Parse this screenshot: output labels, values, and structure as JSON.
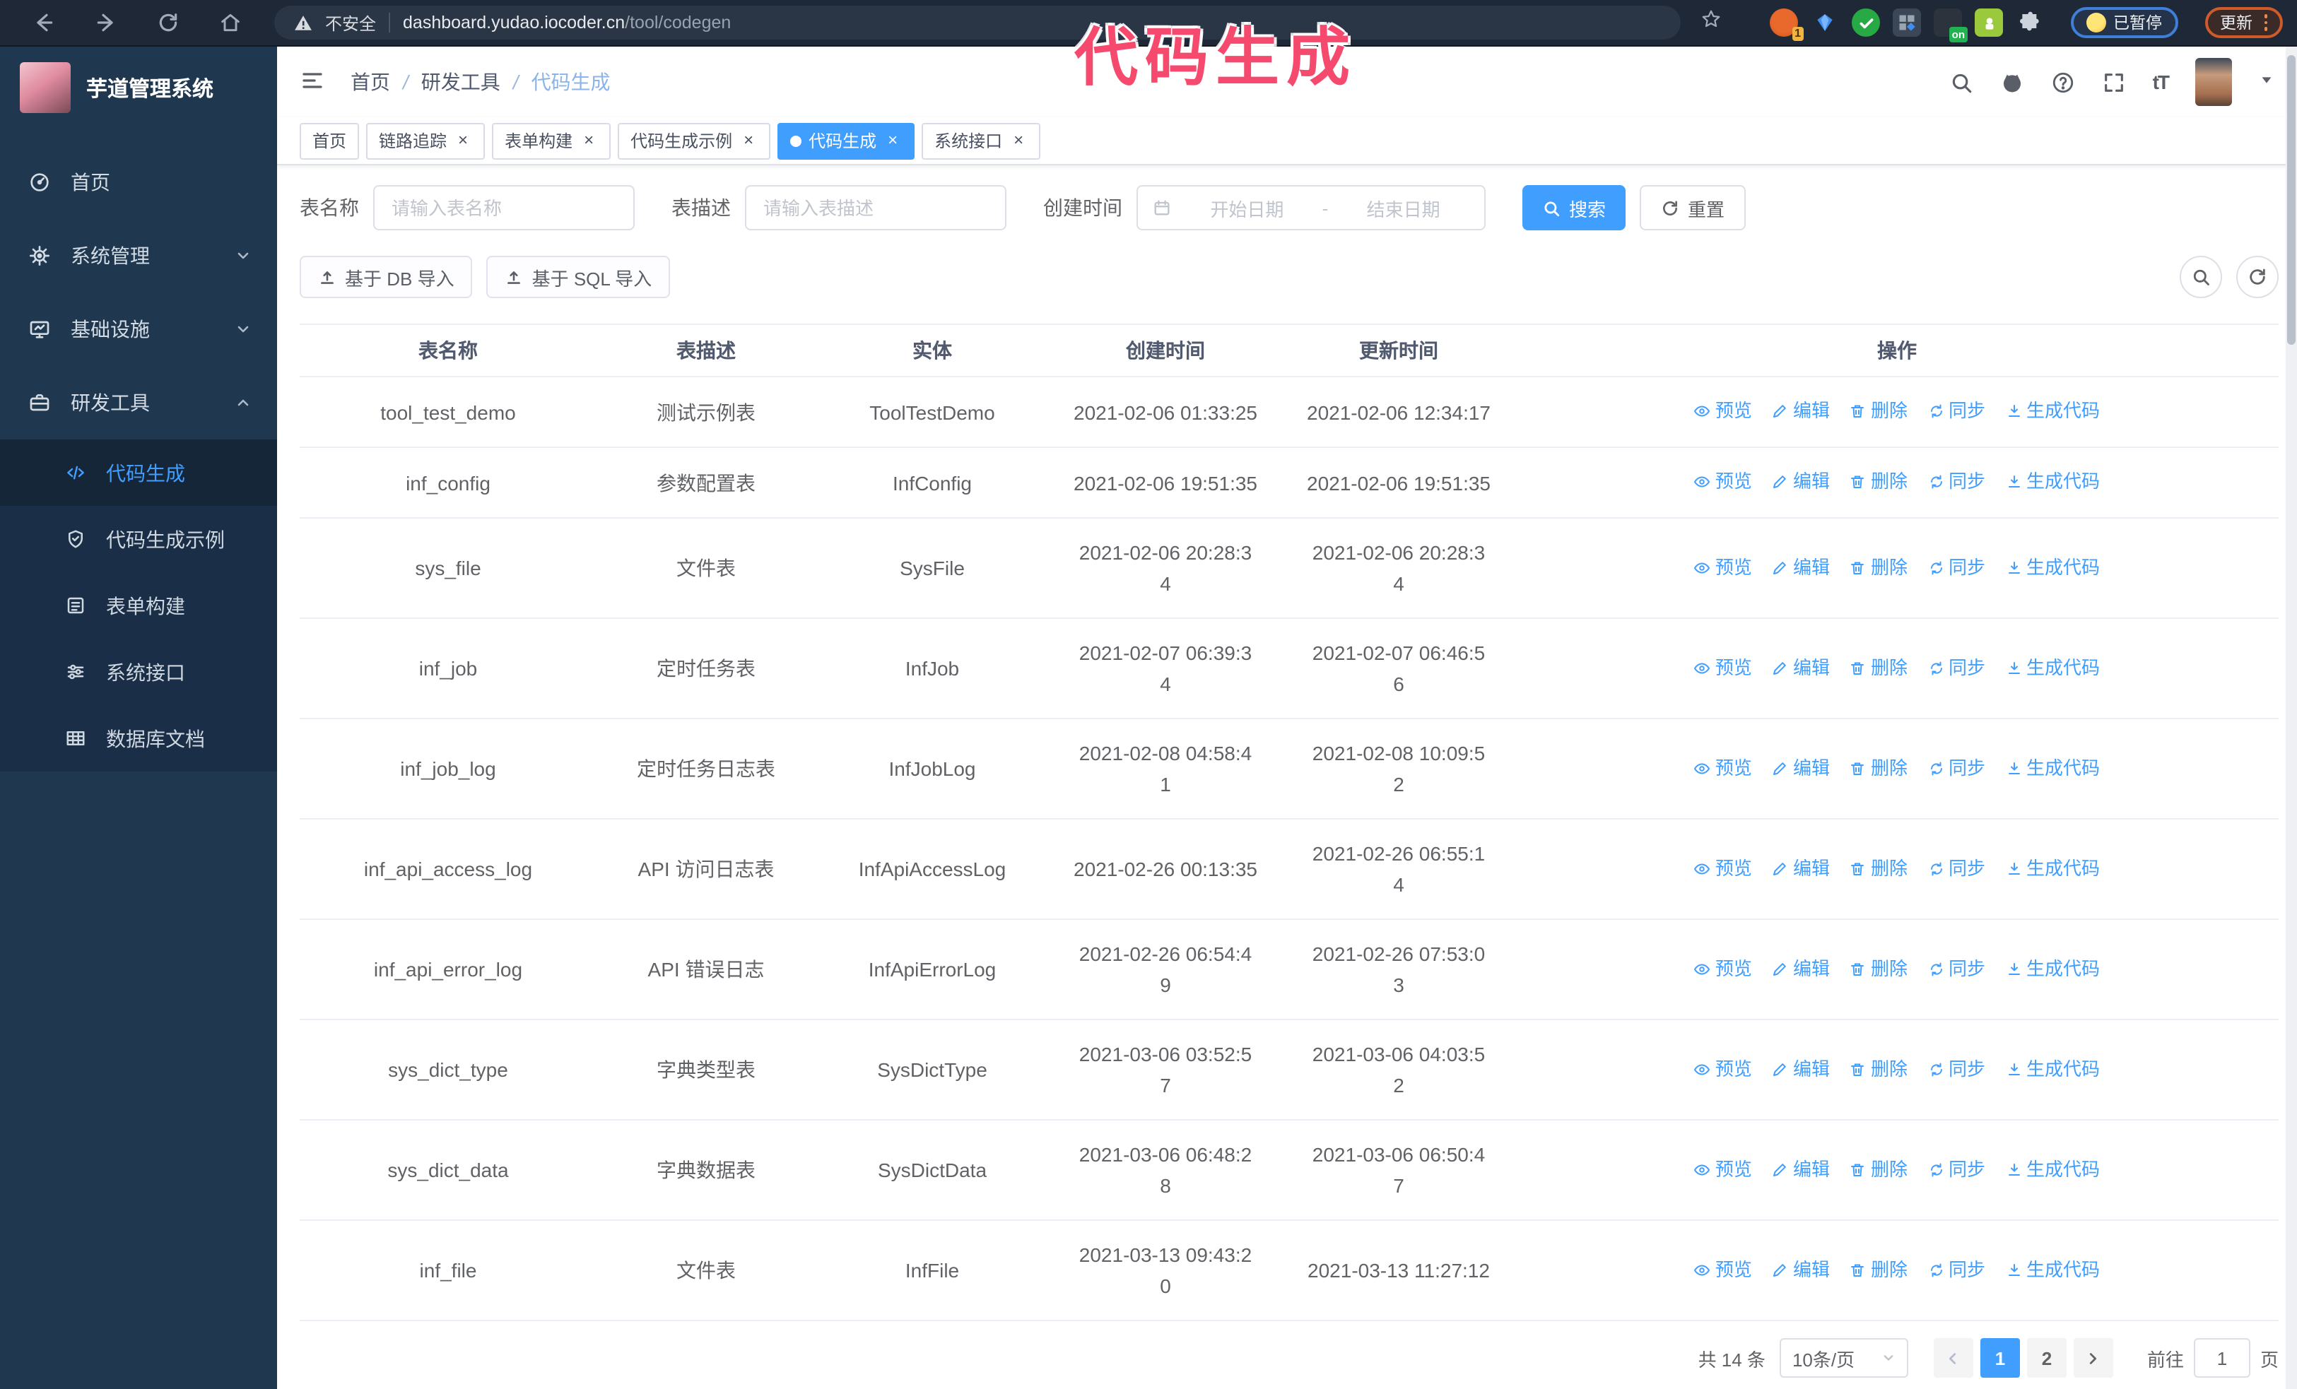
{
  "colors": {
    "accent": "#409eff",
    "annotation": "#f54a6e",
    "sidebar_bg": "#20384f",
    "sidebar_sub_bg": "#1a2f47"
  },
  "browser": {
    "not_secure": "不安全",
    "url_domain": "dashboard.yudao.iocoder.cn",
    "url_path": "/tool/codegen",
    "ext_badge": "1",
    "ext_on_badge": "on",
    "paused_label": "已暂停",
    "update_label": "更新"
  },
  "annotation": {
    "text": "代码生成"
  },
  "sidebar": {
    "title": "芋道管理系统",
    "items": [
      {
        "label": "首页",
        "icon": "dashboard-icon"
      },
      {
        "label": "系统管理",
        "icon": "gear-icon",
        "chevron": "down"
      },
      {
        "label": "基础设施",
        "icon": "monitor-icon",
        "chevron": "down"
      },
      {
        "label": "研发工具",
        "icon": "toolbox-icon",
        "chevron": "up"
      }
    ],
    "sub_items": [
      {
        "label": "代码生成",
        "icon": "code-icon",
        "active": true
      },
      {
        "label": "代码生成示例",
        "icon": "shield-check-icon"
      },
      {
        "label": "表单构建",
        "icon": "form-icon"
      },
      {
        "label": "系统接口",
        "icon": "sliders-icon"
      },
      {
        "label": "数据库文档",
        "icon": "database-icon"
      }
    ]
  },
  "header": {
    "breadcrumb": [
      "首页",
      "研发工具",
      "代码生成"
    ]
  },
  "tabs": [
    {
      "label": "首页",
      "closable": false,
      "active": false
    },
    {
      "label": "链路追踪",
      "closable": true,
      "active": false
    },
    {
      "label": "表单构建",
      "closable": true,
      "active": false
    },
    {
      "label": "代码生成示例",
      "closable": true,
      "active": false
    },
    {
      "label": "代码生成",
      "closable": true,
      "active": true
    },
    {
      "label": "系统接口",
      "closable": true,
      "active": false
    }
  ],
  "filters": {
    "table_name_label": "表名称",
    "table_name_placeholder": "请输入表名称",
    "table_desc_label": "表描述",
    "table_desc_placeholder": "请输入表描述",
    "create_time_label": "创建时间",
    "start_placeholder": "开始日期",
    "range_separator": "-",
    "end_placeholder": "结束日期",
    "search_label": "搜索",
    "reset_label": "重置"
  },
  "toolbar": {
    "import_db_label": "基于 DB 导入",
    "import_sql_label": "基于 SQL 导入"
  },
  "table": {
    "columns": [
      "表名称",
      "表描述",
      "实体",
      "创建时间",
      "更新时间",
      "操作"
    ],
    "actions": [
      {
        "label": "预览",
        "icon": "eye-icon"
      },
      {
        "label": "编辑",
        "icon": "edit-icon"
      },
      {
        "label": "删除",
        "icon": "delete-icon"
      },
      {
        "label": "同步",
        "icon": "sync-icon"
      },
      {
        "label": "生成代码",
        "icon": "download-icon"
      }
    ],
    "rows": [
      {
        "name": "tool_test_demo",
        "desc": "测试示例表",
        "entity": "ToolTestDemo",
        "created": "2021-02-06 01:33:25",
        "updated": "2021-02-06 12:34:17"
      },
      {
        "name": "inf_config",
        "desc": "参数配置表",
        "entity": "InfConfig",
        "created": "2021-02-06 19:51:35",
        "updated": "2021-02-06 19:51:35"
      },
      {
        "name": "sys_file",
        "desc": "文件表",
        "entity": "SysFile",
        "created": "2021-02-06 20:28:3\n4",
        "updated": "2021-02-06 20:28:3\n4"
      },
      {
        "name": "inf_job",
        "desc": "定时任务表",
        "entity": "InfJob",
        "created": "2021-02-07 06:39:3\n4",
        "updated": "2021-02-07 06:46:5\n6"
      },
      {
        "name": "inf_job_log",
        "desc": "定时任务日志表",
        "entity": "InfJobLog",
        "created": "2021-02-08 04:58:4\n1",
        "updated": "2021-02-08 10:09:5\n2"
      },
      {
        "name": "inf_api_access_log",
        "desc": "API 访问日志表",
        "entity": "InfApiAccessLog",
        "created": "2021-02-26 00:13:35",
        "updated": "2021-02-26 06:55:1\n4"
      },
      {
        "name": "inf_api_error_log",
        "desc": "API 错误日志",
        "entity": "InfApiErrorLog",
        "created": "2021-02-26 06:54:4\n9",
        "updated": "2021-02-26 07:53:0\n3"
      },
      {
        "name": "sys_dict_type",
        "desc": "字典类型表",
        "entity": "SysDictType",
        "created": "2021-03-06 03:52:5\n7",
        "updated": "2021-03-06 04:03:5\n2"
      },
      {
        "name": "sys_dict_data",
        "desc": "字典数据表",
        "entity": "SysDictData",
        "created": "2021-03-06 06:48:2\n8",
        "updated": "2021-03-06 06:50:4\n7"
      },
      {
        "name": "inf_file",
        "desc": "文件表",
        "entity": "InfFile",
        "created": "2021-03-13 09:43:2\n0",
        "updated": "2021-03-13 11:27:12"
      }
    ]
  },
  "pagination": {
    "total": "共 14 条",
    "page_size": "10条/页",
    "pages": [
      "1",
      "2"
    ],
    "current": "1",
    "goto_label": "前往",
    "goto_value": "1",
    "goto_suffix": "页"
  }
}
